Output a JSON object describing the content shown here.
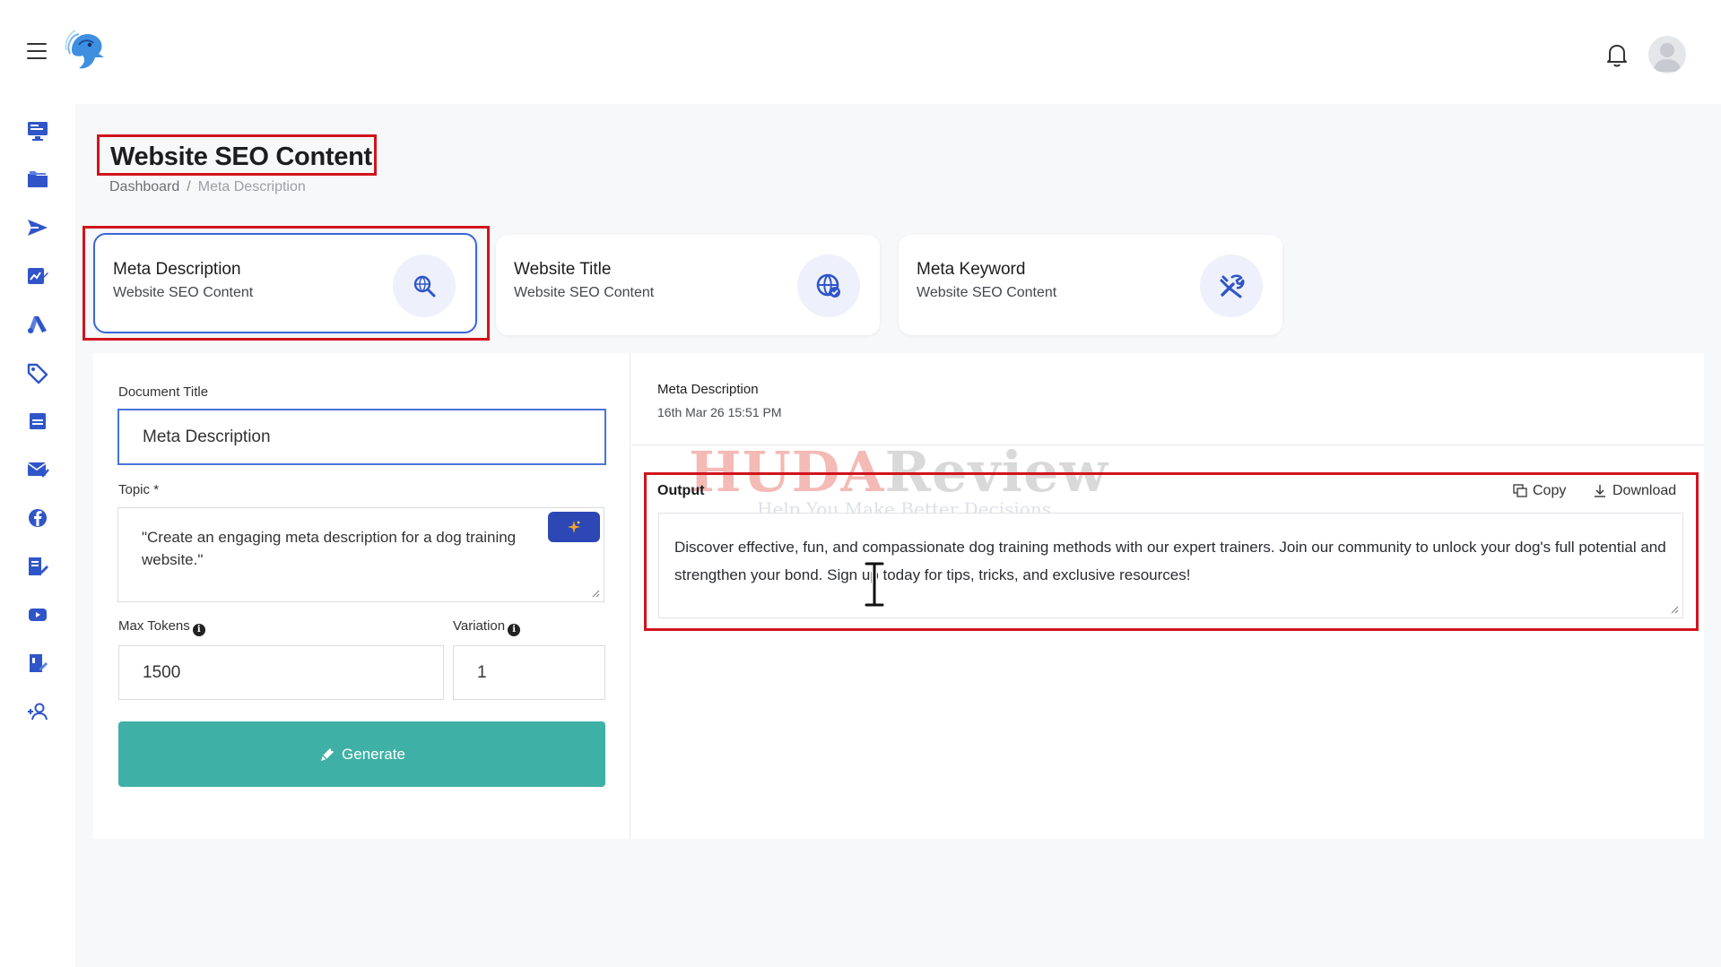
{
  "header": {
    "menu_icon": "hamburger-icon",
    "logo_icon": "bird-logo-icon",
    "notification_icon": "bell-icon",
    "avatar_icon": "user-avatar-icon"
  },
  "sidebar": {
    "items": [
      {
        "icon": "monitor-icon"
      },
      {
        "icon": "folder-icon"
      },
      {
        "icon": "send-icon"
      },
      {
        "icon": "edit-chart-icon"
      },
      {
        "icon": "ads-icon"
      },
      {
        "icon": "tag-icon"
      },
      {
        "icon": "server-icon"
      },
      {
        "icon": "mail-check-icon"
      },
      {
        "icon": "facebook-icon"
      },
      {
        "icon": "document-edit-icon"
      },
      {
        "icon": "youtube-icon"
      },
      {
        "icon": "book-edit-icon"
      },
      {
        "icon": "add-user-icon"
      }
    ]
  },
  "page": {
    "title": "Website SEO Content",
    "breadcrumb": {
      "home": "Dashboard",
      "separator": "/",
      "current": "Meta Description"
    }
  },
  "tool_cards": [
    {
      "title": "Meta Description",
      "subtitle": "Website SEO Content",
      "icon": "search-globe-icon",
      "active": true
    },
    {
      "title": "Website Title",
      "subtitle": "Website SEO Content",
      "icon": "globe-check-icon",
      "active": false
    },
    {
      "title": "Meta Keyword",
      "subtitle": "Website SEO Content",
      "icon": "tools-icon",
      "active": false
    }
  ],
  "form": {
    "document_title_label": "Document Title",
    "document_title_value": "Meta Description",
    "topic_label": "Topic",
    "topic_required_mark": "*",
    "topic_value": "\"Create an engaging meta description for a dog training website.\"",
    "magic_icon": "sparkle-icon",
    "max_tokens_label": "Max Tokens",
    "max_tokens_value": "1500",
    "variation_label": "Variation",
    "variation_value": "1",
    "info_icon": "info-icon",
    "generate_label": "Generate",
    "generate_icon": "pen-icon"
  },
  "result": {
    "title": "Meta Description",
    "date": "16th Mar 26 15:51 PM",
    "output_label": "Output",
    "copy_label": "Copy",
    "copy_icon": "copy-icon",
    "download_label": "Download",
    "download_icon": "download-icon",
    "output_text": "Discover effective, fun, and compassionate dog training methods with our expert trainers. Join our community to unlock your dog's full potential and strengthen your bond. Sign up today for tips, tricks, and exclusive resources!"
  },
  "watermark": {
    "part1": "HUDA",
    "part2": "Review",
    "tagline": "Help You Make Better Decisions"
  },
  "colors": {
    "accent_blue": "#2d48b5",
    "active_border": "#3b66d6",
    "generate_green": "#3fb0a5",
    "highlight_red": "#d0141c",
    "icon_blue": "#2f55c9"
  }
}
